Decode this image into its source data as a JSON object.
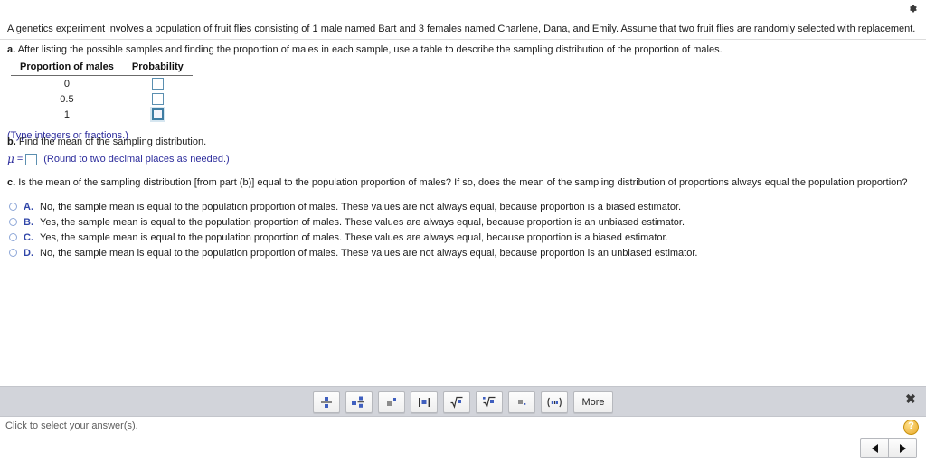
{
  "colors": {
    "accent_blue": "#2f45a8",
    "hint_blue": "#2c2c9c",
    "input_border": "#5b8fb0",
    "palette_bg": "#d2d4da",
    "help_yellow": "#e8a92a"
  },
  "topbar": {
    "gear_icon": "gear-icon"
  },
  "question": {
    "stem": "A genetics experiment involves a population of fruit flies consisting of 1 male named Bart and 3 females named Charlene, Dana, and Emily. Assume that two fruit flies are randomly selected with replacement.",
    "part_a_label": "a.",
    "part_a": "After listing the possible samples and finding the proportion of males in each sample, use a table to describe the sampling distribution of the proportion of males.",
    "part_b_label": "b.",
    "part_b": "Find the mean of the sampling distribution.",
    "part_c_label": "c.",
    "part_c": "Is the mean of the sampling distribution [from part (b)] equal to the population proportion of males? If so, does the mean of the sampling distribution of proportions always equal the population proportion?"
  },
  "table": {
    "headers": [
      "Proportion of males",
      "Probability"
    ],
    "rows": [
      {
        "proportion": "0",
        "probability_value": "",
        "focused": false
      },
      {
        "proportion": "0.5",
        "probability_value": "",
        "focused": false
      },
      {
        "proportion": "1",
        "probability_value": "",
        "focused": true
      }
    ],
    "hint": "(Type integers or fractions.)"
  },
  "mean": {
    "symbol": "μ",
    "equals": "=",
    "value": "",
    "hint": "(Round to two decimal places as needed.)"
  },
  "choices": [
    {
      "letter": "A.",
      "text": "No, the sample mean is equal to the population proportion of males. These values are not always equal, because proportion is a biased estimator.",
      "selected": false
    },
    {
      "letter": "B.",
      "text": "Yes, the sample mean is equal to the population proportion of males. These values are always equal, because proportion is an unbiased estimator.",
      "selected": false
    },
    {
      "letter": "C.",
      "text": "Yes, the sample mean is equal to the population proportion of males. These values are always equal, because proportion is a biased estimator.",
      "selected": false
    },
    {
      "letter": "D.",
      "text": "No, the sample mean is equal to the population proportion of males. These values are not always equal, because proportion is an unbiased estimator.",
      "selected": false
    }
  ],
  "palette": {
    "buttons": [
      {
        "name": "fraction-icon",
        "label": ""
      },
      {
        "name": "mixed-number-icon",
        "label": ""
      },
      {
        "name": "exponent-icon",
        "label": ""
      },
      {
        "name": "absolute-value-icon",
        "label": ""
      },
      {
        "name": "square-root-icon",
        "label": ""
      },
      {
        "name": "nth-root-icon",
        "label": ""
      },
      {
        "name": "decimal-list-icon",
        "label": ""
      },
      {
        "name": "interval-notation-icon",
        "label": ""
      }
    ],
    "more_label": "More",
    "close_label": "✖"
  },
  "status": {
    "text": "Click to select your answer(s).",
    "help_label": "?"
  },
  "nav": {
    "prev_label": "◀",
    "next_label": "▶"
  }
}
